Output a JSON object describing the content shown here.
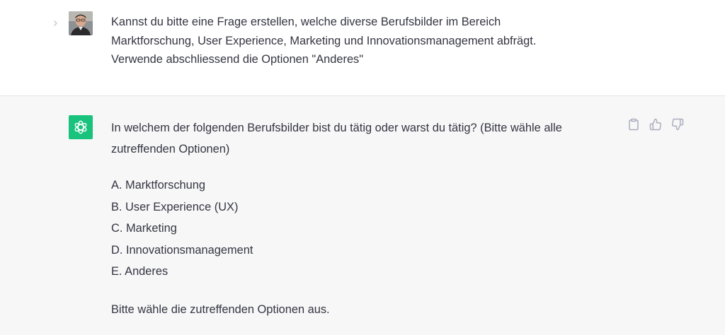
{
  "user_message": {
    "text": "Kannst du bitte eine Frage erstellen, welche diverse Berufsbilder im Bereich\nMarktforschung, User Experience, Marketing und Innovationsmanagement abfrägt.\nVerwende abschliessend die Optionen \"Anderes\""
  },
  "assistant_message": {
    "intro": "In welchem der folgenden Berufsbilder bist du tätig oder warst du tätig? (Bitte wähle alle zutreffenden Optionen)",
    "options": [
      "A. Marktforschung",
      "B. User Experience (UX)",
      "C. Marketing",
      "D. Innovationsmanagement",
      "E. Anderes"
    ],
    "outro": "Bitte wähle die zutreffenden Optionen aus."
  },
  "icons": {
    "collapse": "chevron-right-icon",
    "copy": "clipboard-icon",
    "like": "thumbs-up-icon",
    "dislike": "thumbs-down-icon",
    "assistant": "openai-logo-icon"
  },
  "colors": {
    "assistant_avatar_bg": "#19c37d",
    "assistant_row_bg": "#f7f7f8",
    "text": "#343541",
    "icon": "#acacbe"
  }
}
